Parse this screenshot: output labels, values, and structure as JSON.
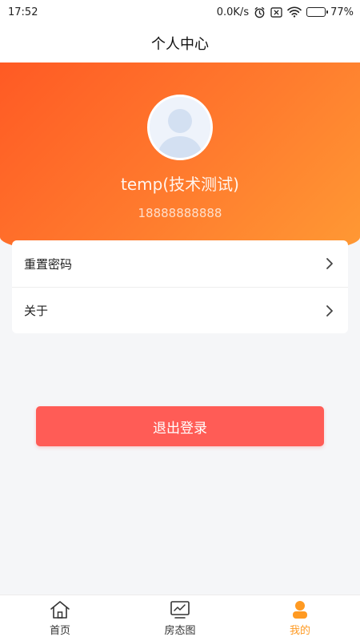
{
  "status_bar": {
    "time": "17:52",
    "network_speed": "0.0K/s",
    "battery_percent": "77%",
    "battery_level": 0.77,
    "icons": [
      "alarm-icon",
      "sim-disabled-icon",
      "wifi-icon",
      "battery-icon"
    ]
  },
  "nav": {
    "title": "个人中心"
  },
  "profile": {
    "name": "temp(技术测试)",
    "phone": "18888888888"
  },
  "menu": {
    "items": [
      {
        "label": "重置密码",
        "icon": "chevron-right-icon"
      },
      {
        "label": "关于",
        "icon": "chevron-right-icon"
      }
    ]
  },
  "logout": {
    "label": "退出登录"
  },
  "tabs": [
    {
      "label": "首页",
      "icon": "home-icon",
      "active": false
    },
    {
      "label": "房态图",
      "icon": "chart-icon",
      "active": false
    },
    {
      "label": "我的",
      "icon": "user-icon",
      "active": true
    }
  ],
  "colors": {
    "accent": "#ff9a22",
    "header_gradient_start": "#ff5a24",
    "header_gradient_end": "#ff9a34",
    "logout_button": "#ff5c56"
  }
}
